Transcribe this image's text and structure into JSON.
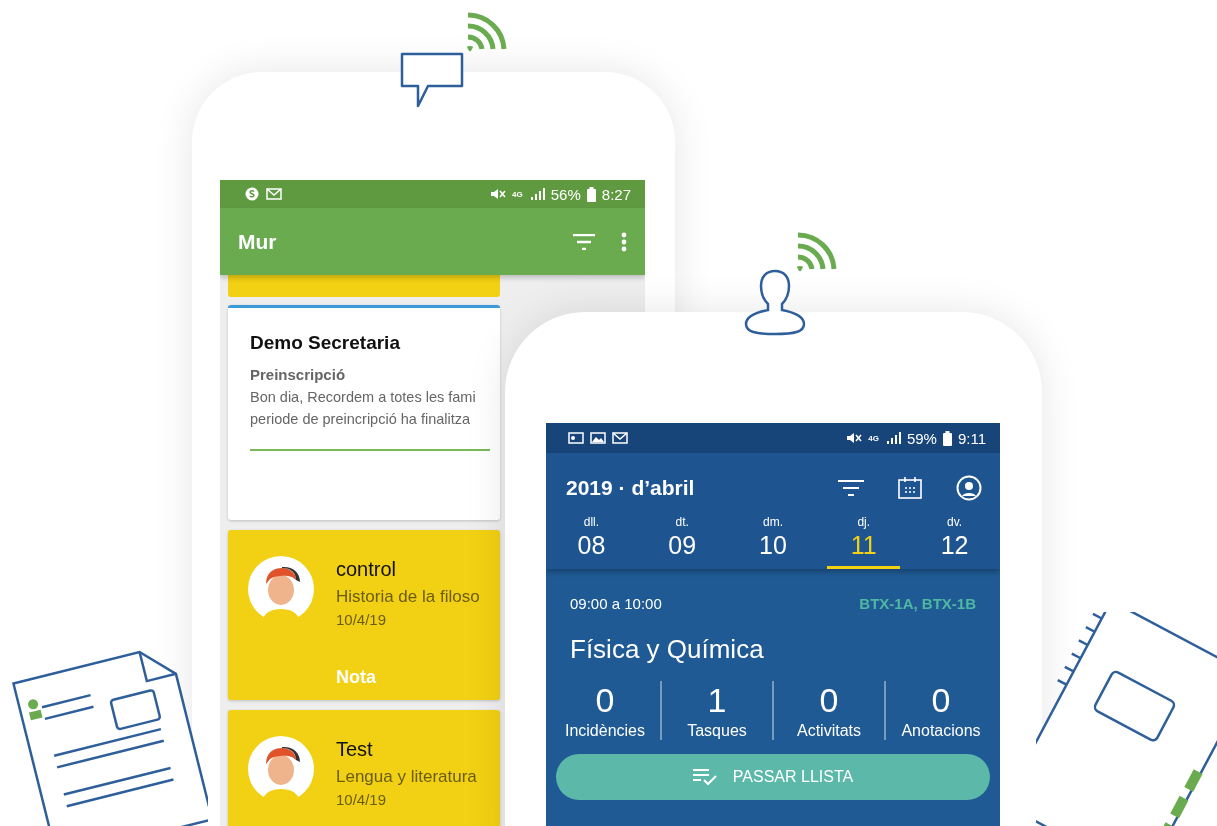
{
  "wall_phone": {
    "status": {
      "network": "4G",
      "battery": "56%",
      "time": "8:27"
    },
    "title": "Mur",
    "posts": [
      {
        "kind": "message",
        "author": "Demo Secretaria",
        "subject": "Preinscripció",
        "lines": [
          "Bon dia, Recordem a totes les fami",
          "periode de preincripció ha finalitza"
        ]
      },
      {
        "kind": "note",
        "author": "control",
        "subject": "Historia de la filoso",
        "date": "10/4/19",
        "footer": "Nota"
      },
      {
        "kind": "note",
        "author": "Test",
        "subject": "Lengua  y literatura",
        "date": "10/4/19"
      }
    ]
  },
  "schedule_phone": {
    "status": {
      "network": "4G",
      "battery": "59%",
      "time": "9:11"
    },
    "title": "2019 · d’abril",
    "days": [
      {
        "weekday": "dll.",
        "date": "08",
        "selected": false
      },
      {
        "weekday": "dt.",
        "date": "09",
        "selected": false
      },
      {
        "weekday": "dm.",
        "date": "10",
        "selected": false
      },
      {
        "weekday": "dj.",
        "date": "11",
        "selected": true
      },
      {
        "weekday": "dv.",
        "date": "12",
        "selected": false
      }
    ],
    "session": {
      "time": "09:00 a 10:00",
      "groups": "BTX-1A, BTX-1B",
      "subject": "Física y Química",
      "stats": [
        {
          "value": "0",
          "label": "Incidències"
        },
        {
          "value": "1",
          "label": "Tasques"
        },
        {
          "value": "0",
          "label": "Activitats"
        },
        {
          "value": "0",
          "label": "Anotacions"
        }
      ],
      "action": "PASSAR LLISTA"
    }
  }
}
